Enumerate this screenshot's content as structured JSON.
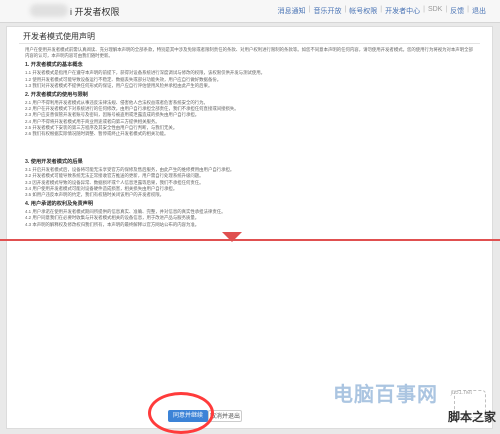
{
  "header": {
    "brand": "i 开发者权限",
    "nav": [
      "消息通知",
      "音乐开放",
      "帐号权限",
      "开发者中心",
      "SDK",
      "反馈",
      "退出"
    ]
  },
  "page_title": "开发者模式使用声明",
  "intro": "用户在使用开发者模式前需认真阅读、充分理解本声明的全部条款，特别是其中涉及免除或者限制责任的条款、对用户权利进行限制的条款等。如您不同意本声明的任何内容，请勿使用开发者模式。您的使用行为将视为对本声明全部内容的认可，本声明内容可由我们随时更新。",
  "sections": [
    {
      "heading": "1. 开发者模式的基本概念",
      "items": [
        "1.1 开发者模式是指用户在遵守本声明的前提下，获得对设备系统进行深度调试与修改的权限，该权限仅供开发与测试使用。",
        "1.2 使用开发者模式可能导致设备运行不稳定、数据丢失或部分功能失效，用户应自行做好数据备份。",
        "1.3 我们对开发者模式不提供任何形式的保证，用户应自行评估使用风险并承担由此产生的后果。"
      ]
    },
    {
      "heading": "2. 开发者模式的使用与限制",
      "items": [
        "2.1 用户不得利用开发者模式从事违反法律法规、侵害他人合法权益或者危害系统安全的行为。",
        "2.2 用户在开发者模式下对系统进行的任何修改，由用户自行承担全部责任，我们不承担任何直接或间接损失。",
        "2.3 用户应妥善保管开发者账号及密码，因账号被盗用或泄露造成的损失由用户自行承担。",
        "2.4 用户不得将开发者模式用于商业用途或者向第三方提供相关服务。",
        "2.5 开发者模式下安装的第三方程序及其安全性由用户自行判断，与我们无关。",
        "2.6 我们有权根据实际情况随时调整、暂停或终止开发者模式的相关功能。"
      ]
    },
    {
      "heading": "3. 使用开发者模式的后果",
      "items": [
        "3.1 开启开发者模式后，设备将可能无法享受官方的保修及售后服务，由此产生的维修费用由用户自行承担。",
        "3.2 开发者模式可能导致系统无法正常接收官方推送的更新，用户需自行处理系统升级问题。",
        "3.3 因开发者模式导致的设备异常、数据损坏或个人信息泄露等后果，我们不承担任何责任。",
        "3.4 用户使用开发者模式可能对设备硬件造成损害，相关损失由用户自行承担。",
        "3.5 如用户违反本声明的约定，我们有权随时关闭该用户的开发者权限。"
      ]
    },
    {
      "heading": "4. 用户承诺的权利及免责声明",
      "items": [
        "4.1 用户承诺在使用开发者模式期间所提供的信息真实、准确、完整，并对信息的真实性承担法律责任。",
        "4.2 用户同意我们在必要时收集与开发者模式相关的设备信息，用于改进产品与服务质量。",
        "4.3 本声明的解释权及修改权归我们所有，本声明的最终解释以官方网站公布的内容为准。"
      ]
    }
  ],
  "buttons": {
    "agree": "同意并继续",
    "disagree": "取消并退出"
  },
  "watermark": {
    "main": "电脑百事网",
    "site": "jb51.net",
    "brand": "脚本之家"
  }
}
